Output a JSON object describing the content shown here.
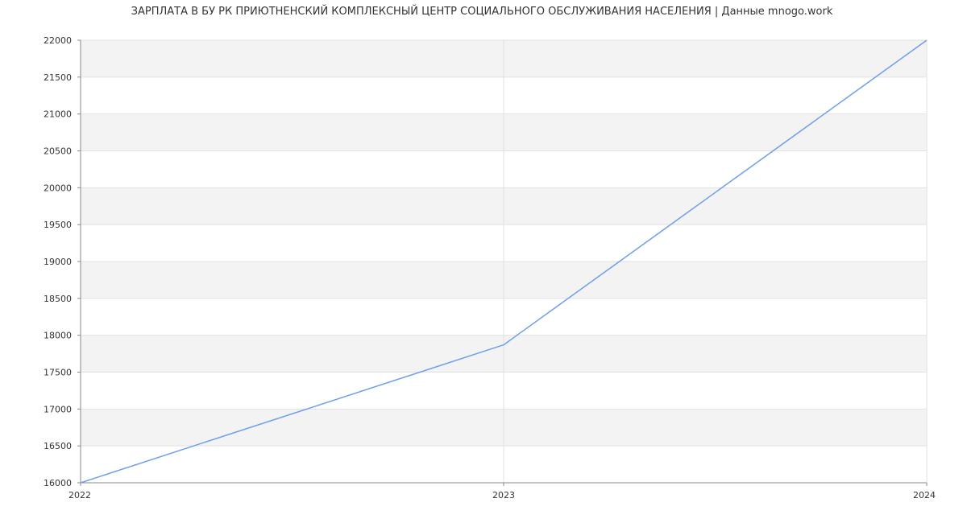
{
  "chart_data": {
    "type": "line",
    "title": "ЗАРПЛАТА В БУ РК  ПРИЮТНЕНСКИЙ КОМПЛЕКСНЫЙ ЦЕНТР СОЦИАЛЬНОГО ОБСЛУЖИВАНИЯ НАСЕЛЕНИЯ | Данные mnogo.work",
    "xlabel": "",
    "ylabel": "",
    "x": [
      "2022",
      "2023",
      "2024"
    ],
    "series": [
      {
        "values": [
          16000,
          17870,
          22000
        ]
      }
    ],
    "ylim": [
      16000,
      22000
    ],
    "yticks": [
      16000,
      16500,
      17000,
      17500,
      18000,
      18500,
      19000,
      19500,
      20000,
      20500,
      21000,
      21500,
      22000
    ],
    "grid": true,
    "banded_background": true,
    "legend": "none",
    "colors": {
      "line": "#6f9eea",
      "band": "#f3f3f3",
      "grid": "#e2e2e2",
      "axis": "#888888",
      "text": "#333333"
    }
  }
}
